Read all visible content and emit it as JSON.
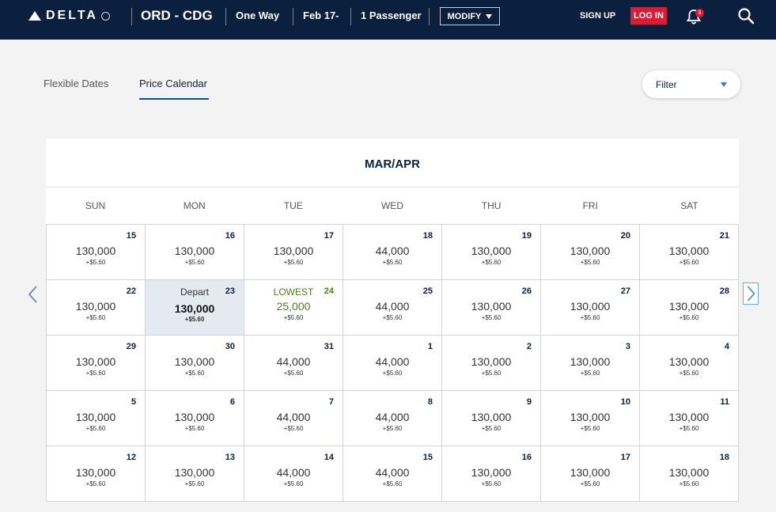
{
  "header": {
    "brand": "DELTA",
    "route": "ORD - CDG",
    "trip_type": "One Way",
    "date": "Feb 17-",
    "passengers": "1 Passenger",
    "modify_label": "MODIFY",
    "signup_label": "SIGN UP",
    "login_label": "LOG IN",
    "notification_count": "3"
  },
  "tabs": [
    {
      "label": "Flexible Dates"
    },
    {
      "label": "Price Calendar",
      "active": true
    }
  ],
  "filter": {
    "label": "Filter"
  },
  "calendar": {
    "month_label": "MAR/APR",
    "weekdays": [
      "SUN",
      "MON",
      "TUE",
      "WED",
      "THU",
      "FRI",
      "SAT"
    ],
    "cells": [
      {
        "day": "15",
        "miles": "130,000",
        "fee": "+$5.60"
      },
      {
        "day": "16",
        "miles": "130,000",
        "fee": "+$5.60"
      },
      {
        "day": "17",
        "miles": "130,000",
        "fee": "+$5.60"
      },
      {
        "day": "18",
        "miles": "44,000",
        "fee": "+$5.60"
      },
      {
        "day": "19",
        "miles": "130,000",
        "fee": "+$5.60"
      },
      {
        "day": "20",
        "miles": "130,000",
        "fee": "+$5.60"
      },
      {
        "day": "21",
        "miles": "130,000",
        "fee": "+$5.60"
      },
      {
        "day": "22",
        "miles": "130,000",
        "fee": "+$5.60"
      },
      {
        "day": "23",
        "miles": "130,000",
        "fee": "+$5.60",
        "tag": "Depart",
        "state": "selected"
      },
      {
        "day": "24",
        "miles": "25,000",
        "fee": "+$5.60",
        "tag": "LOWEST",
        "state": "lowest"
      },
      {
        "day": "25",
        "miles": "44,000",
        "fee": "+$5.60"
      },
      {
        "day": "26",
        "miles": "130,000",
        "fee": "+$5.60"
      },
      {
        "day": "27",
        "miles": "130,000",
        "fee": "+$5.60"
      },
      {
        "day": "28",
        "miles": "130,000",
        "fee": "+$5.60"
      },
      {
        "day": "29",
        "miles": "130,000",
        "fee": "+$5.60"
      },
      {
        "day": "30",
        "miles": "130,000",
        "fee": "+$5.60"
      },
      {
        "day": "31",
        "miles": "44,000",
        "fee": "+$5.60"
      },
      {
        "day": "1",
        "miles": "44,000",
        "fee": "+$5.60"
      },
      {
        "day": "2",
        "miles": "130,000",
        "fee": "+$5.60"
      },
      {
        "day": "3",
        "miles": "130,000",
        "fee": "+$5.60"
      },
      {
        "day": "4",
        "miles": "130,000",
        "fee": "+$5.60"
      },
      {
        "day": "5",
        "miles": "130,000",
        "fee": "+$5.60"
      },
      {
        "day": "6",
        "miles": "130,000",
        "fee": "+$5.60"
      },
      {
        "day": "7",
        "miles": "44,000",
        "fee": "+$5.60"
      },
      {
        "day": "8",
        "miles": "44,000",
        "fee": "+$5.60"
      },
      {
        "day": "9",
        "miles": "130,000",
        "fee": "+$5.60"
      },
      {
        "day": "10",
        "miles": "130,000",
        "fee": "+$5.60"
      },
      {
        "day": "11",
        "miles": "130,000",
        "fee": "+$5.60"
      },
      {
        "day": "12",
        "miles": "130,000",
        "fee": "+$5.60"
      },
      {
        "day": "13",
        "miles": "130,000",
        "fee": "+$5.60"
      },
      {
        "day": "14",
        "miles": "44,000",
        "fee": "+$5.60"
      },
      {
        "day": "15",
        "miles": "44,000",
        "fee": "+$5.60"
      },
      {
        "day": "16",
        "miles": "130,000",
        "fee": "+$5.60"
      },
      {
        "day": "17",
        "miles": "130,000",
        "fee": "+$5.60"
      },
      {
        "day": "18",
        "miles": "130,000",
        "fee": "+$5.60"
      }
    ]
  },
  "colors": {
    "header_bg": "#0b1f3f",
    "login_red": "#e01933",
    "lowest_green": "#4a7f1f",
    "selected_bg": "#e5e9f1",
    "accent_blue": "#3477c7"
  },
  "icons": [
    "delta-logo-icon",
    "bell-icon",
    "search-icon",
    "chevron-left-icon",
    "chevron-right-icon",
    "dropdown-caret-icon"
  ]
}
